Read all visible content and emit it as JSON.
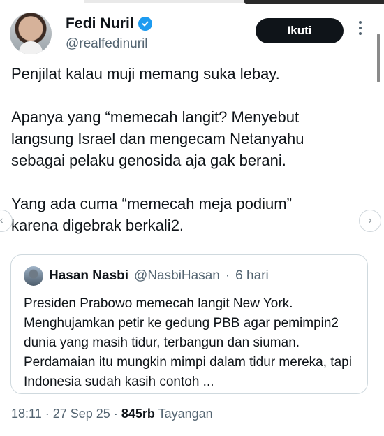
{
  "author": {
    "display_name": "Fedi Nuril",
    "handle": "@realfedinuril",
    "verified_icon": "verified-badge-icon",
    "follow_label": "Ikuti"
  },
  "tweet": {
    "paragraphs": [
      "Penjilat kalau muji memang suka lebay.",
      "Apanya yang “memecah langit? Menyebut\nlangsung Israel dan mengecam Netanyahu\nsebagai pelaku genosida aja gak berani.",
      "Yang ada cuma “memecah meja podium”\nkarena digebrak berkali2."
    ]
  },
  "quoted": {
    "display_name": "Hasan Nasbi",
    "handle": "@NasbiHasan",
    "separator": "·",
    "time": "6 hari",
    "text": "Presiden Prabowo memecah langit New York. Menghujamkan petir ke gedung PBB agar pemimpin2 dunia yang masih tidur, terbangun dan siuman. Perdamaian itu mungkin mimpi dalam tidur mereka, tapi Indonesia sudah kasih contoh ..."
  },
  "meta": {
    "time": "18:11",
    "sep1": "·",
    "date": "27 Sep 25",
    "sep2": "·",
    "views_count": "845rb",
    "views_label": "Tayangan"
  },
  "nav": {
    "prev_icon": "chevron-left-icon",
    "next_icon": "chevron-right-icon"
  },
  "colors": {
    "text": "#0f1419",
    "secondary": "#536471",
    "verified": "#1d9bf0",
    "button_bg": "#0f1419",
    "border": "#cfd9de"
  }
}
